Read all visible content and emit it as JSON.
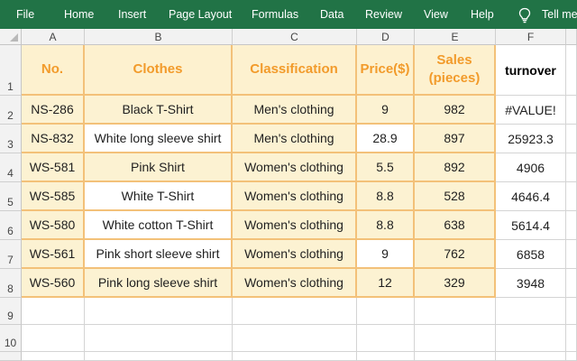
{
  "ribbon": {
    "tabs": [
      "File",
      "Home",
      "Insert",
      "Page Layout",
      "Formulas",
      "Data",
      "Review",
      "View",
      "Help"
    ],
    "tell_me": "Tell me"
  },
  "columns": [
    "A",
    "B",
    "C",
    "D",
    "E",
    "F"
  ],
  "rows": [
    "1",
    "2",
    "3",
    "4",
    "5",
    "6",
    "7",
    "8",
    "9",
    "10"
  ],
  "table": {
    "headers": [
      "No.",
      "Clothes",
      "Classification",
      "Price($)",
      "Sales\n(pieces)"
    ],
    "turnover_header": "turnover",
    "rows": [
      [
        "NS-286",
        "Black T-Shirt",
        "Men's clothing",
        "9",
        "982",
        "#VALUE!"
      ],
      [
        "NS-832",
        "White long sleeve shirt",
        "Men's clothing",
        "28.9",
        "897",
        "25923.3"
      ],
      [
        "WS-581",
        "Pink Shirt",
        "Women's clothing",
        "5.5",
        "892",
        "4906"
      ],
      [
        "WS-585",
        "White T-Shirt",
        "Women's clothing",
        "8.8",
        "528",
        "4646.4"
      ],
      [
        "WS-580",
        "White cotton T-Shirt",
        "Women's clothing",
        "8.8",
        "638",
        "5614.4"
      ],
      [
        "WS-561",
        "Pink short sleeve shirt",
        "Women's clothing",
        "9",
        "762",
        "6858"
      ],
      [
        "WS-560",
        "Pink long sleeve shirt",
        "Women's clothing",
        "12",
        "329",
        "3948"
      ]
    ]
  },
  "colors": {
    "ribbon": "#217346",
    "header_text": "#f29b2b",
    "cream": "#fcf2d2",
    "table_border": "#f3c179"
  }
}
